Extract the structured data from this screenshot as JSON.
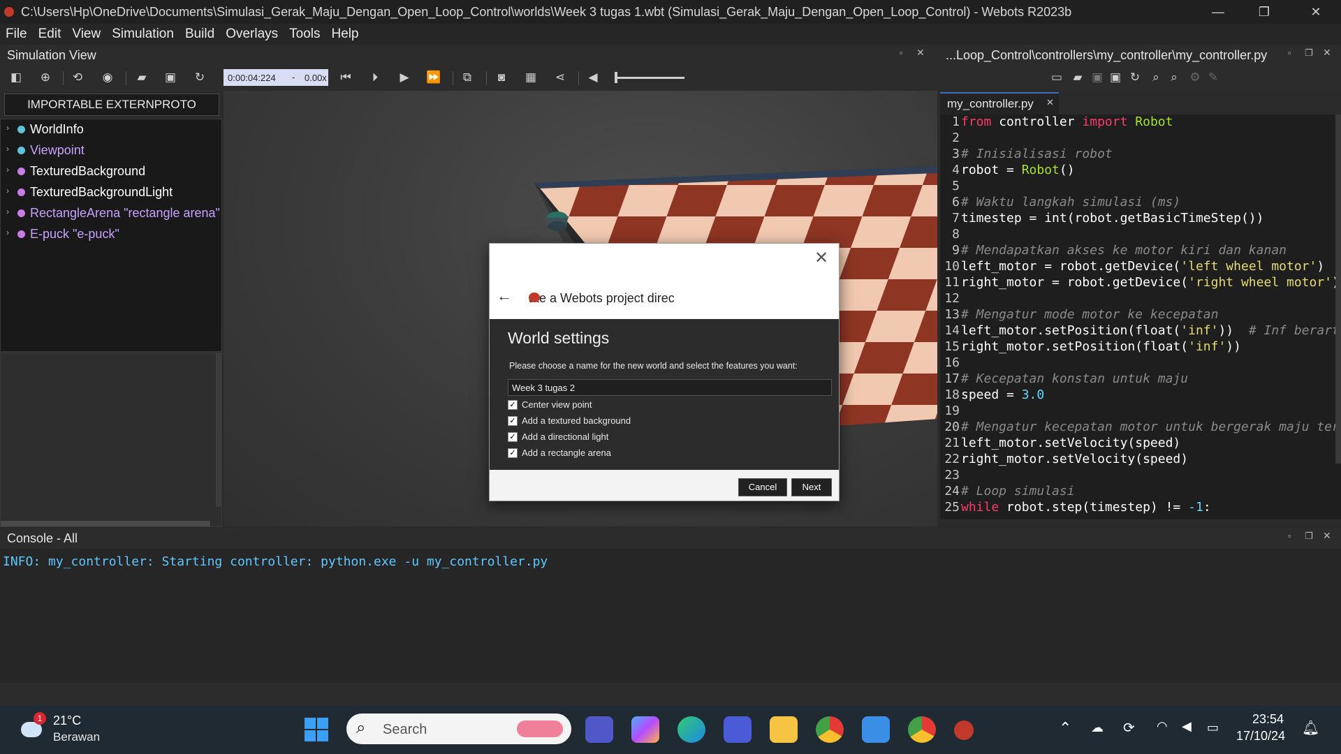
{
  "titlebar": {
    "title": "C:\\Users\\Hp\\OneDrive\\Documents\\Simulasi_Gerak_Maju_Dengan_Open_Loop_Control\\worlds\\Week 3 tugas 1.wbt (Simulasi_Gerak_Maju_Dengan_Open_Loop_Control) - Webots R2023b",
    "minimize": "—",
    "restore": "❐",
    "close": "✕"
  },
  "menu": [
    "File",
    "Edit",
    "View",
    "Simulation",
    "Build",
    "Overlays",
    "Tools",
    "Help"
  ],
  "simulation_view": {
    "title": "Simulation View",
    "time": "0:00:04:224",
    "speed_sep": "-",
    "speed": "0.00x",
    "importable_button": "IMPORTABLE EXTERNPROTO",
    "tree": [
      {
        "label": "WorldInfo",
        "dot": "#5fc3d9",
        "color": "#ffffff"
      },
      {
        "label": "Viewpoint",
        "dot": "#5fc3d9",
        "color": "#c6a2ff"
      },
      {
        "label": "TexturedBackground",
        "dot": "#c97be6",
        "color": "#ffffff"
      },
      {
        "label": "TexturedBackgroundLight",
        "dot": "#c97be6",
        "color": "#ffffff"
      },
      {
        "label": "RectangleArena \"rectangle arena\"",
        "dot": "#c97be6",
        "color": "#c6a2ff"
      },
      {
        "label": "E-puck \"e-puck\"",
        "dot": "#c97be6",
        "color": "#c6a2ff"
      }
    ]
  },
  "dialog": {
    "header": "ate a Webots project direc",
    "heading": "World settings",
    "prompt": "Please choose a name for the new world and select the features you want:",
    "world_name": "Week 3 tugas 2",
    "options": [
      {
        "label": "Center view point",
        "checked": true
      },
      {
        "label": "Add a textured background",
        "checked": true
      },
      {
        "label": "Add a directional light",
        "checked": true
      },
      {
        "label": "Add a rectangle arena",
        "checked": true
      }
    ],
    "cancel": "Cancel",
    "next": "Next",
    "close_glyph": "✕",
    "back_glyph": "←"
  },
  "editor": {
    "path_title": "...Loop_Control\\controllers\\my_controller\\my_controller.py",
    "tab": "my_controller.py",
    "lines": [
      "from controller import Robot",
      "",
      "# Inisialisasi robot",
      "robot = Robot()",
      "",
      "# Waktu langkah simulasi (ms)",
      "timestep = int(robot.getBasicTimeStep())",
      "",
      "# Mendapatkan akses ke motor kiri dan kanan",
      "left_motor = robot.getDevice('left wheel motor')",
      "right_motor = robot.getDevice('right wheel motor')",
      "",
      "# Mengatur mode motor ke kecepatan",
      "left_motor.setPosition(float('inf'))  # Inf berarti",
      "right_motor.setPosition(float('inf'))",
      "",
      "# Kecepatan konstan untuk maju",
      "speed = 3.0",
      "",
      "# Mengatur kecepatan motor untuk bergerak maju terus",
      "left_motor.setVelocity(speed)",
      "right_motor.setVelocity(speed)",
      "",
      "# Loop simulasi",
      "while robot.step(timestep) != -1:"
    ]
  },
  "console": {
    "title": "Console - All",
    "line": "INFO: my_controller: Starting controller: python.exe -u my_controller.py"
  },
  "taskbar": {
    "weather_temp": "21°C",
    "weather_desc": "Berawan",
    "weather_badge": "1",
    "search_placeholder": "Search",
    "time": "23:54",
    "date": "17/10/24"
  }
}
